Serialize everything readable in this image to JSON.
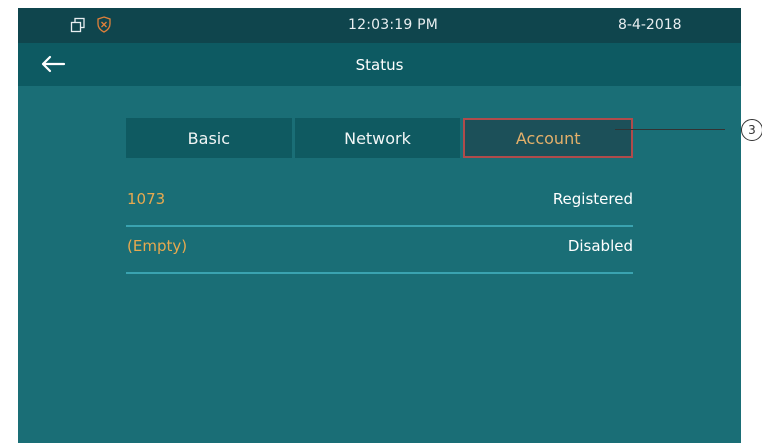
{
  "status_bar": {
    "time": "12:03:19   PM",
    "date": "8-4-2018"
  },
  "header": {
    "title": "Status"
  },
  "tabs": [
    {
      "label": "Basic",
      "active": false
    },
    {
      "label": "Network",
      "active": false
    },
    {
      "label": "Account",
      "active": true
    }
  ],
  "accounts": [
    {
      "name": "1073",
      "state": "Registered"
    },
    {
      "name": "(Empty)",
      "state": "Disabled"
    }
  ],
  "callout": {
    "label": "3"
  },
  "colors": {
    "background": "#1a6e76",
    "status_bar": "#0f454d",
    "title_bar": "#0d5a62",
    "tab": "#0f5a61",
    "active_tab_text": "#e4b06a",
    "active_tab_border": "#b04b4b",
    "account_name": "#e7a94f",
    "divider": "#3aa3b0"
  }
}
